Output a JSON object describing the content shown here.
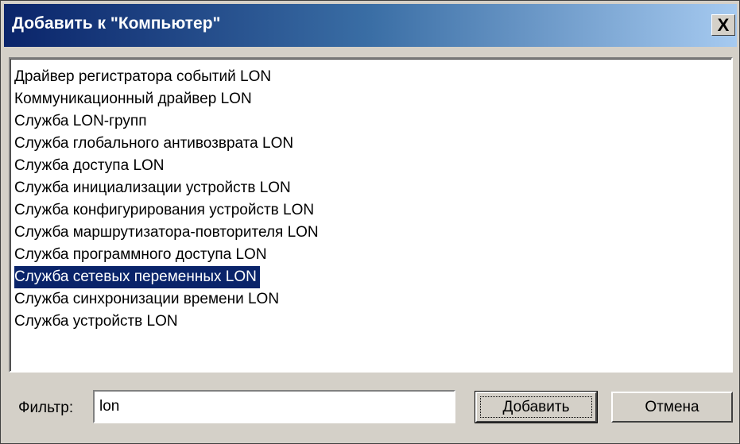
{
  "window": {
    "title": "Добавить к \"Компьютер\"",
    "close_label": "X"
  },
  "list": {
    "items": [
      "Драйвер регистратора событий LON",
      "Коммуникационный драйвер LON",
      "Служба LON-групп",
      "Служба глобального антивозврата LON",
      "Служба доступа LON",
      "Служба инициализации устройств LON",
      "Служба конфигурирования устройств LON",
      "Служба маршрутизатора-повторителя LON",
      "Служба программного доступа LON",
      "Служба сетевых переменных LON",
      "Служба синхронизации времени LON",
      "Служба устройств LON"
    ],
    "selected_index": 9
  },
  "filter": {
    "label": "Фильтр:",
    "value": "lon"
  },
  "buttons": {
    "add_label": "Добавить",
    "cancel_label": "Отмена"
  },
  "colors": {
    "title_gradient_start": "#0a246a",
    "title_gradient_end": "#a6caf0",
    "selection_bg": "#0a246a",
    "dialog_bg": "#d4d0c8"
  }
}
